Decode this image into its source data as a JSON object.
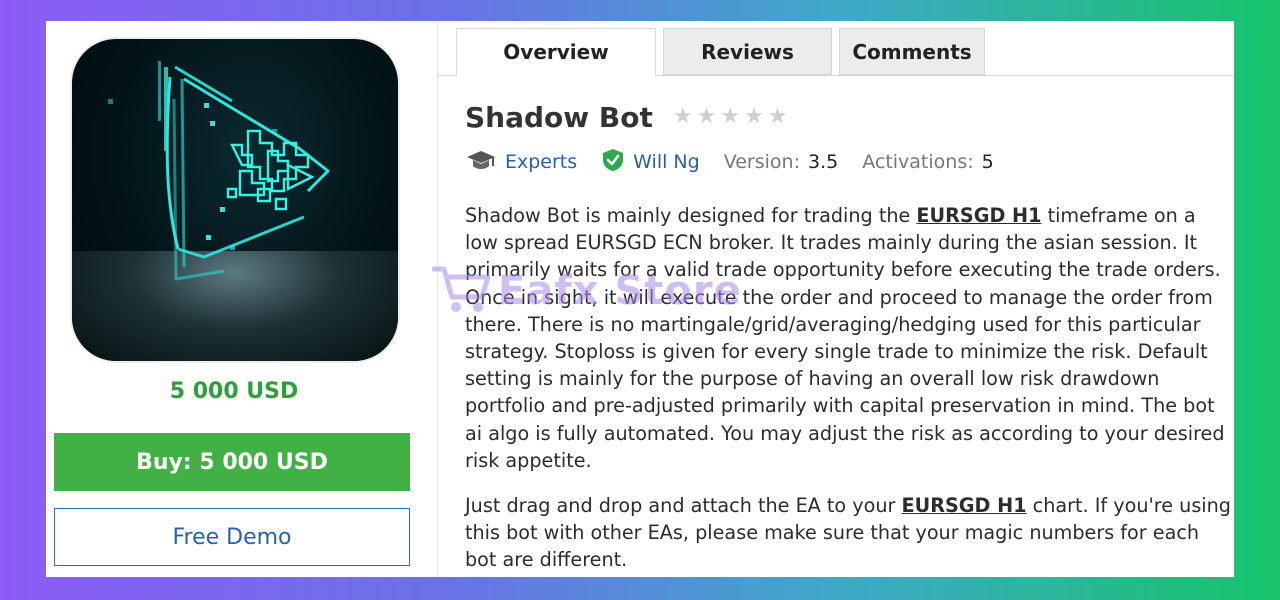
{
  "product": {
    "image_alt_icon": "neon-play-logo",
    "price": "5 000 USD",
    "buy_label": "Buy: 5 000 USD",
    "demo_label": "Free Demo"
  },
  "tabs": [
    {
      "label": "Overview",
      "active": true
    },
    {
      "label": "Reviews",
      "active": false
    },
    {
      "label": "Comments",
      "active": false
    }
  ],
  "header": {
    "title": "Shadow Bot",
    "rating": 0,
    "rating_max": 5
  },
  "meta": {
    "category": "Experts",
    "author": "Will Ng",
    "version_label": "Version:",
    "version_value": "3.5",
    "activations_label": "Activations:",
    "activations_value": "5"
  },
  "description": {
    "p1_part1": "Shadow Bot is mainly designed for trading the ",
    "p1_link": "EURSGD H1",
    "p1_part2": " timeframe on a low spread EURSGD ECN broker. It trades mainly during the asian session. It primarily waits for a valid trade opportunity before executing the trade orders. Once in sight, it will execute the order and proceed to manage the order from there. There is no martingale/grid/averaging/hedging used for this particular strategy. Stoploss is given for every single trade to minimize the risk. Default setting is mainly for the purpose of having an overall low risk drawdown portfolio and pre-adjusted primarily with capital preservation in mind. The bot ai algo is fully automated. You may adjust the risk as according to your desired risk appetite.",
    "p2_part1": "Just drag and drop and attach the EA to your ",
    "p2_link": "EURSGD H1",
    "p2_part2": " chart. If you're using this bot with other EAs, please make sure that your magic numbers for each bot are different."
  },
  "watermark": {
    "text": "Eafx Store",
    "icon": "shopping-cart-icon"
  },
  "colors": {
    "price_green": "#2f9e3a",
    "buy_green": "#41b146",
    "link_blue": "#2a5fa8",
    "verified_green": "#2fa84f",
    "star_gray": "#cfcfcf"
  }
}
